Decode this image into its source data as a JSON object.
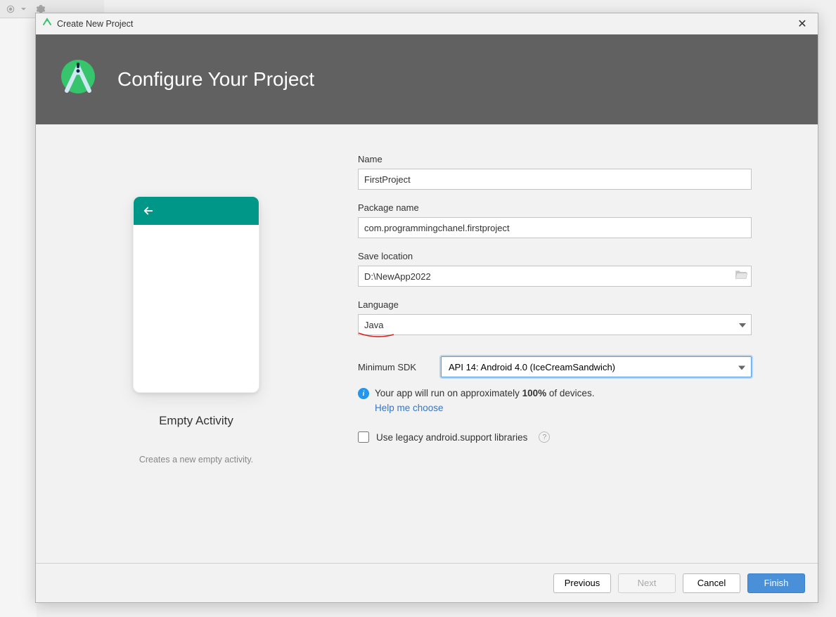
{
  "window": {
    "title": "Create New Project"
  },
  "header": {
    "title": "Configure Your Project"
  },
  "preview": {
    "title": "Empty Activity",
    "description": "Creates a new empty activity."
  },
  "form": {
    "name_label": "Name",
    "name_value": "FirstProject",
    "package_label": "Package name",
    "package_value": "com.programmingchanel.firstproject",
    "location_label": "Save location",
    "location_value": "D:\\NewApp2022",
    "language_label": "Language",
    "language_value": "Java",
    "minsdk_label": "Minimum SDK",
    "minsdk_value": "API 14: Android 4.0 (IceCreamSandwich)",
    "info_text_left": "Your app will run on approximately ",
    "info_percent": "100%",
    "info_text_right": " of devices.",
    "help_link": "Help me choose",
    "legacy_label": "Use legacy android.support libraries"
  },
  "footer": {
    "previous": "Previous",
    "next": "Next",
    "cancel": "Cancel",
    "finish": "Finish"
  }
}
